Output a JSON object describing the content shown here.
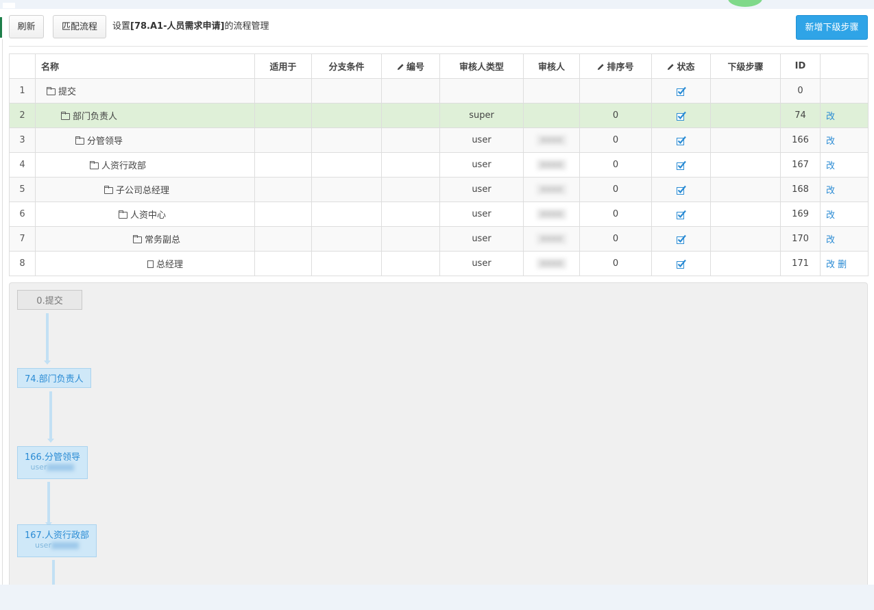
{
  "toolbar": {
    "refresh_label": "刷新",
    "match_label": "匹配流程",
    "title_prefix": "设置",
    "title_name": "[78.A1-人员需求申请]",
    "title_suffix": "的流程管理",
    "add_label": "新增下级步骤"
  },
  "table": {
    "columns": {
      "name": "名称",
      "applies": "适用于",
      "branch": "分支条件",
      "code": "编号",
      "approver_type": "审核人类型",
      "approver": "审核人",
      "sort": "排序号",
      "status": "状态",
      "next": "下级步骤",
      "id": "ID"
    },
    "edit_label": "改",
    "delete_label": "删",
    "rows": [
      {
        "n": "1",
        "name": "提交",
        "type": "",
        "sort": "",
        "id": "0"
      },
      {
        "n": "2",
        "name": "部门负责人",
        "type": "super",
        "sort": "0",
        "id": "74"
      },
      {
        "n": "3",
        "name": "分管领导",
        "type": "user",
        "sort": "0",
        "id": "166"
      },
      {
        "n": "4",
        "name": "人资行政部",
        "type": "user",
        "sort": "0",
        "id": "167"
      },
      {
        "n": "5",
        "name": "子公司总经理",
        "type": "user",
        "sort": "0",
        "id": "168"
      },
      {
        "n": "6",
        "name": "人资中心",
        "type": "user",
        "sort": "0",
        "id": "169"
      },
      {
        "n": "7",
        "name": "常务副总",
        "type": "user",
        "sort": "0",
        "id": "170"
      },
      {
        "n": "8",
        "name": "总经理",
        "type": "user",
        "sort": "0",
        "id": "171"
      }
    ]
  },
  "flow": {
    "nodes": [
      {
        "label": "0.提交"
      },
      {
        "label": "74.部门负责人"
      },
      {
        "label": "166.分管领导",
        "sub": "user"
      },
      {
        "label": "167.人资行政部",
        "sub": "user"
      }
    ]
  }
}
